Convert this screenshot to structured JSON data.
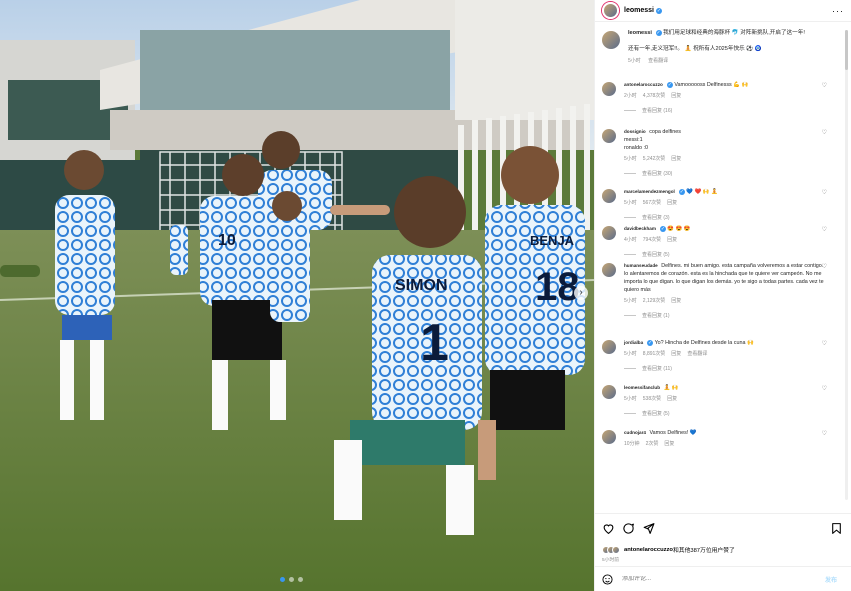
{
  "post": {
    "username": "leomessi",
    "more_icon": "more-horizontal-icon",
    "caption_lines": [
      "我们用足球和经典的海豚杯 🐬 对阵新挑队,开启了这一年!",
      "还有一年,走义冠军!!。 🧘 祝所有人2025年快乐 ⚽ 🧿"
    ],
    "caption_time": "5小时",
    "caption_translate": "查看翻译"
  },
  "comments": [
    {
      "user": "antonelaroccuzzo",
      "verified": true,
      "text": "Vamoooooss Delfinesss 💪 🙌",
      "time": "2小时",
      "likes": "4,378次赞",
      "reply": "回复",
      "replies": "查看回复 (16)"
    },
    {
      "user": "dossignio",
      "verified": false,
      "text": "copa delfines\nmessi:1\nronaldo :0",
      "time": "5小时",
      "likes": "5,242次赞",
      "reply": "回复",
      "replies": "查看回复 (30)"
    },
    {
      "user": "marcelamendezmengol",
      "verified": true,
      "text": "💙 ❤️ 🙌 🧘",
      "time": "5小时",
      "likes": "567次赞",
      "reply": "回复",
      "replies": "查看回复 (3)"
    },
    {
      "user": "davidbeckham",
      "verified": true,
      "text": "😍 😍 😍",
      "time": "4小时",
      "likes": "794次赞",
      "reply": "回复",
      "replies": "查看回复 (5)"
    },
    {
      "user": "humanseudade",
      "verified": false,
      "text": "Delfines. mi buen amigo. esta campaña volveremos a estar contigo. lo alentaremos de corazón. esta es la hinchada que te quiere ver campeón. No me importa lo que digan. lo que digan los demás. yo te sigo a todas partes. cada vez te quiero más",
      "time": "5小时",
      "likes": "2,129次赞",
      "reply": "回复",
      "replies": "查看回复 (1)"
    },
    {
      "user": "jordialba",
      "verified": true,
      "text": "Yo? Hincha de Delfines desde la cuna 🙌",
      "time": "5小时",
      "likes": "8,891次赞",
      "reply": "回复",
      "replies": "查看回复 (11)",
      "extra": "查看翻译"
    },
    {
      "user": "leomessifanclub",
      "verified": false,
      "text": "🧘 🙌",
      "time": "5小时",
      "likes": "538次赞",
      "reply": "回复",
      "replies": "查看回复 (5)"
    },
    {
      "user": "cudnojar4",
      "verified": false,
      "text": "Vamos Delfines! 💙",
      "time": "10分钟",
      "likes": "2次赞",
      "reply": "回复",
      "replies": ""
    }
  ],
  "actions": {
    "like_icon": "heart-icon",
    "comment_icon": "comment-icon",
    "share_icon": "send-icon",
    "save_icon": "bookmark-icon"
  },
  "likes": {
    "user": "antonelaroccuzzo",
    "text": "和其他387万位用户赞了",
    "ago": "5小时前"
  },
  "compose": {
    "emoji_icon": "emoji-icon",
    "placeholder": "添加评论...",
    "post_label": "发布"
  },
  "photo": {
    "next_icon": "chevron-right-icon",
    "dots_total": 3,
    "dot_active": 1,
    "jersey_names": [
      "SIMON",
      "BENJA"
    ],
    "jersey_numbers": [
      "1",
      "10",
      "18"
    ]
  },
  "colors": {
    "accent": "#3897f0",
    "jersey_blue": "#2f7fd6"
  }
}
